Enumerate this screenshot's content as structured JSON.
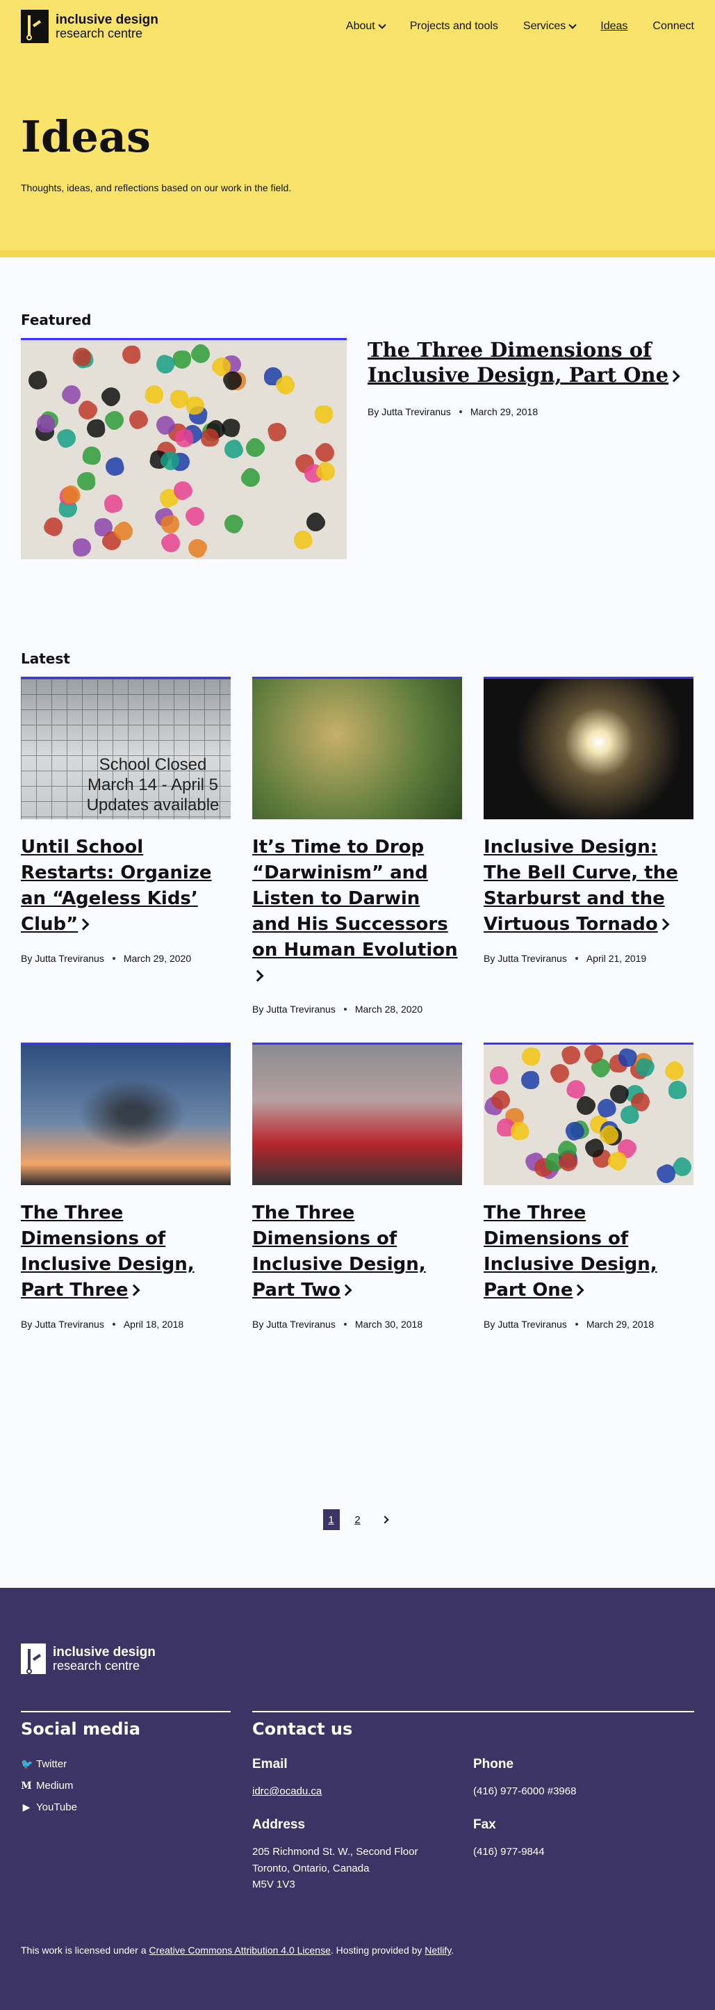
{
  "site": {
    "logo_line1": "inclusive design",
    "logo_line2": "research centre"
  },
  "nav": {
    "items": [
      {
        "label": "About",
        "has_dropdown": true
      },
      {
        "label": "Projects and tools",
        "has_dropdown": false
      },
      {
        "label": "Services",
        "has_dropdown": true
      },
      {
        "label": "Ideas",
        "active": true
      },
      {
        "label": "Connect"
      }
    ]
  },
  "hero": {
    "title": "Ideas",
    "subtitle": "Thoughts, ideas, and reflections based on our work in the field."
  },
  "featured": {
    "heading": "Featured",
    "title": "The Three Dimensions of Inclusive Design, Part One",
    "author": "By Jutta Treviranus",
    "date": "March 29, 2018"
  },
  "latest": {
    "heading": "Latest",
    "cards": [
      {
        "title": "Until School Restarts: Organize an “Ageless Kids’ Club”",
        "author": "By Jutta Treviranus",
        "date": "March 29, 2020",
        "image_text": [
          "School Closed",
          "March 14 - April 5",
          "Updates available"
        ]
      },
      {
        "title": "It’s Time to Drop “Darwinism” and Listen to Darwin and His Successors on Human Evolution",
        "author": "By Jutta Treviranus",
        "date": "March 28, 2020"
      },
      {
        "title": "Inclusive Design: The Bell Curve, the Starburst and the Virtuous Tornado",
        "author": "By Jutta Treviranus",
        "date": "April 21, 2019"
      },
      {
        "title": "The Three Dimensions of Inclusive Design, Part Three",
        "author": "By Jutta Treviranus",
        "date": "April 18, 2018"
      },
      {
        "title": "The Three Dimensions of Inclusive Design, Part Two",
        "author": "By Jutta Treviranus",
        "date": "March 30, 2018"
      },
      {
        "title": "The Three Dimensions of Inclusive Design, Part One",
        "author": "By Jutta Treviranus",
        "date": "March 29, 2018"
      }
    ]
  },
  "pagination": {
    "pages": [
      "1",
      "2"
    ],
    "current": "1"
  },
  "footer": {
    "logo_line1": "inclusive design",
    "logo_line2": "research centre",
    "social_heading": "Social media",
    "social": [
      {
        "icon": "twitter-icon",
        "label": "Twitter"
      },
      {
        "icon": "medium-icon",
        "label": "Medium"
      },
      {
        "icon": "youtube-icon",
        "label": "YouTube"
      }
    ],
    "contact_heading": "Contact us",
    "email_heading": "Email",
    "email": "idrc@ocadu.ca",
    "phone_heading": "Phone",
    "phone": "(416) 977-6000 #3968",
    "address_heading": "Address",
    "address_lines": [
      "205 Richmond St. W., Second Floor",
      "Toronto, Ontario, Canada",
      "M5V 1V3"
    ],
    "fax_heading": "Fax",
    "fax": "(416) 977-9844",
    "license_pre": "This work is licensed under a ",
    "license_link": "Creative Commons Attribution 4.0 License",
    "license_mid": ". Hosting provided by ",
    "hosting_link": "Netlify",
    "license_post": "."
  },
  "colors": {
    "hero_bg": "#f9e36a",
    "footer_bg": "#3c3464",
    "image_border": "#3a34ff",
    "page_bg": "#fafbff"
  }
}
